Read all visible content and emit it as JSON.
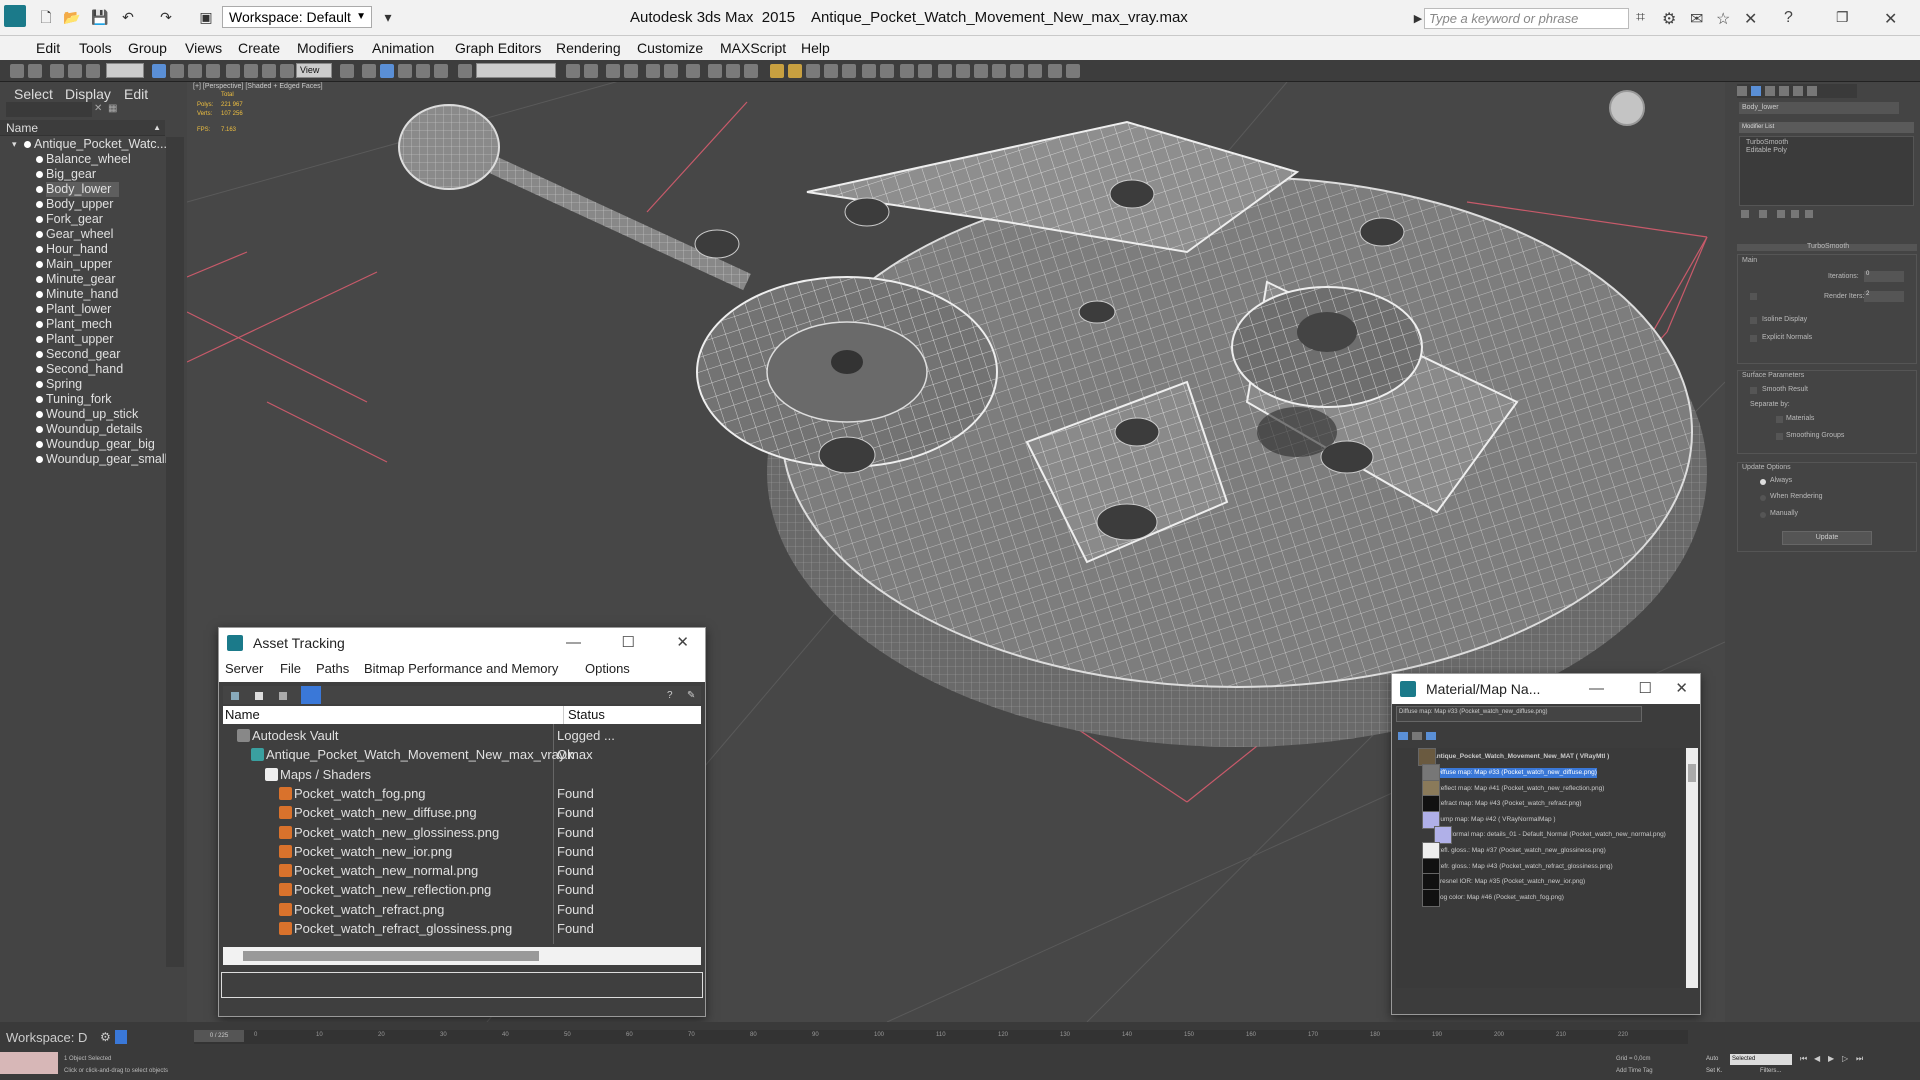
{
  "window": {
    "app_title": "Autodesk 3ds Max  2015    Antique_Pocket_Watch_Movement_New_max_vray.max",
    "workspace_label": "Workspace: Default",
    "search_placeholder": "Type a keyword or phrase"
  },
  "menu": [
    "Edit",
    "Tools",
    "Group",
    "Views",
    "Create",
    "Modifiers",
    "Animation",
    "Graph Editors",
    "Rendering",
    "Customize",
    "MAXScript",
    "Help"
  ],
  "toolbar": {
    "view_dropdown": "View"
  },
  "scene_explorer": {
    "tabs": [
      "Select",
      "Display",
      "Edit"
    ],
    "column_header": "Name",
    "root": "Antique_Pocket_Watc...",
    "items": [
      "Balance_wheel",
      "Big_gear",
      "Body_lower",
      "Body_upper",
      "Fork_gear",
      "Gear_wheel",
      "Hour_hand",
      "Main_upper",
      "Minute_gear",
      "Minute_hand",
      "Plant_lower",
      "Plant_mech",
      "Plant_upper",
      "Second_gear",
      "Second_hand",
      "Spring",
      "Tuning_fork",
      "Wound_up_stick",
      "Woundup_details",
      "Woundup_gear_big",
      "Woundup_gear_small"
    ],
    "selected_index": 2
  },
  "viewport": {
    "label": "[+] [Perspective] [Shaded + Edged Faces]",
    "stats": {
      "total_label": "Total",
      "polys_label": "Polys:",
      "polys_value": "221 967",
      "verts_label": "Verts:",
      "verts_value": "107 256",
      "fps_label": "FPS:",
      "fps_value": "7.163"
    }
  },
  "asset_tracking": {
    "title": "Asset Tracking",
    "menu": [
      "Server",
      "File",
      "Paths",
      "Bitmap Performance and Memory",
      "Options"
    ],
    "columns": [
      "Name",
      "Status"
    ],
    "rows": [
      {
        "name": "Autodesk Vault",
        "status": "Logged ...",
        "indent": 0
      },
      {
        "name": "Antique_Pocket_Watch_Movement_New_max_vray.max",
        "status": "Ok",
        "indent": 1
      },
      {
        "name": "Maps / Shaders",
        "status": "",
        "indent": 2
      },
      {
        "name": "Pocket_watch_fog.png",
        "status": "Found",
        "indent": 3
      },
      {
        "name": "Pocket_watch_new_diffuse.png",
        "status": "Found",
        "indent": 3
      },
      {
        "name": "Pocket_watch_new_glossiness.png",
        "status": "Found",
        "indent": 3
      },
      {
        "name": "Pocket_watch_new_ior.png",
        "status": "Found",
        "indent": 3
      },
      {
        "name": "Pocket_watch_new_normal.png",
        "status": "Found",
        "indent": 3
      },
      {
        "name": "Pocket_watch_new_reflection.png",
        "status": "Found",
        "indent": 3
      },
      {
        "name": "Pocket_watch_refract.png",
        "status": "Found",
        "indent": 3
      },
      {
        "name": "Pocket_watch_refract_glossiness.png",
        "status": "Found",
        "indent": 3
      }
    ]
  },
  "material_navigator": {
    "title": "Material/Map Na...",
    "header_field": "Diffuse map: Map #33 (Pocket_watch_new_diffuse.png)",
    "root": "Antique_Pocket_Watch_Movement_New_MAT  ( VRayMtl )",
    "rows": [
      "Diffuse map: Map #33 (Pocket_watch_new_diffuse.png)",
      "Reflect map: Map #41 (Pocket_watch_new_reflection.png)",
      "Refract map: Map #43 (Pocket_watch_refract.png)",
      "Bump map: Map #42  ( VRayNormalMap )",
      "Normal map: details_01 - Default_Normal (Pocket_watch_new_normal.png)",
      "Refl. gloss.: Map #37 (Pocket_watch_new_glossiness.png)",
      "Refr. gloss.: Map #43 (Pocket_watch_refract_glossiness.png)",
      "Fresnel IOR: Map #35 (Pocket_watch_new_ior.png)",
      "Fog color: Map #46 (Pocket_watch_fog.png)"
    ]
  },
  "modify_panel": {
    "object_name": "Body_lower",
    "modifier_list": "Modifier List",
    "stack": [
      "TurboSmooth",
      "Editable Poly"
    ],
    "rollout_title": "TurboSmooth",
    "main_label": "Main",
    "iterations_label": "Iterations:",
    "iterations_value": "0",
    "render_iters_label": "Render Iters:",
    "render_iters_value": "2",
    "isoline_label": "Isoline Display",
    "explicit_label": "Explicit Normals",
    "surface_label": "Surface Parameters",
    "smooth_result": "Smooth Result",
    "separate_by": "Separate by:",
    "materials": "Materials",
    "smoothing_groups": "Smoothing Groups",
    "update_options": "Update Options",
    "always": "Always",
    "when_rendering": "When Rendering",
    "manually": "Manually",
    "update_button": "Update"
  },
  "status": {
    "workspace_short": "Workspace: D",
    "frame": "0 / 225",
    "selected": "1 Object Selected",
    "hint": "Click or click-and-drag to select objects",
    "grid": "Grid = 0,0cm",
    "autokey": "Auto",
    "selected_dd": "Selected",
    "add_time_tag": "Add Time Tag",
    "set_key": "Set K.",
    "filters": "Filters..."
  },
  "timeline_ticks": [
    "0",
    "10",
    "20",
    "30",
    "40",
    "50",
    "60",
    "70",
    "80",
    "90",
    "100",
    "110",
    "120",
    "130",
    "140",
    "150",
    "160",
    "170",
    "180",
    "190",
    "200",
    "210",
    "220"
  ],
  "colors": {
    "accent": "#3a78d8",
    "selection": "#5e5e5e",
    "wire": "#d8d8d8",
    "bbox": "#c85a6a"
  }
}
